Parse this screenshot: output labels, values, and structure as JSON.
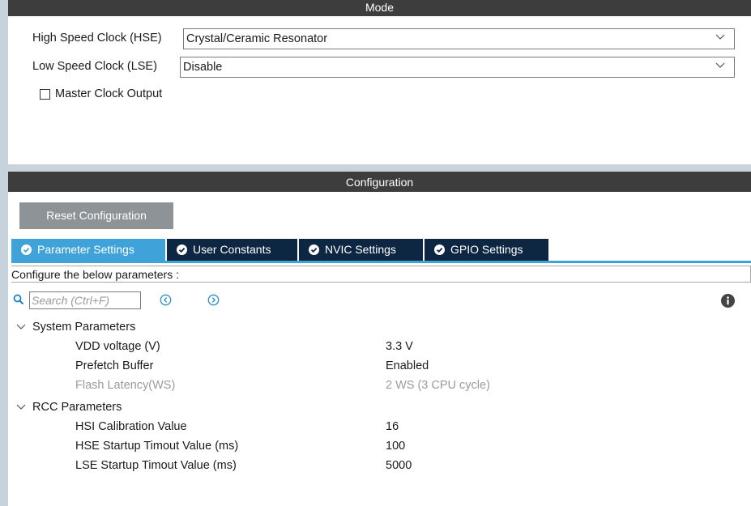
{
  "mode": {
    "title": "Mode",
    "hse": {
      "label": "High Speed Clock (HSE)",
      "value": "Crystal/Ceramic Resonator"
    },
    "lse": {
      "label": "Low Speed Clock (LSE)",
      "value": "Disable"
    },
    "mco": {
      "label": "Master Clock Output",
      "checked": false
    }
  },
  "config": {
    "title": "Configuration",
    "reset_label": "Reset Configuration",
    "tabs": [
      {
        "label": "Parameter Settings",
        "active": true
      },
      {
        "label": "User Constants",
        "active": false
      },
      {
        "label": "NVIC Settings",
        "active": false
      },
      {
        "label": "GPIO Settings",
        "active": false
      }
    ],
    "description": "Configure the below parameters :",
    "search_placeholder": "Search (Ctrl+F)",
    "groups": [
      {
        "label": "System Parameters",
        "params": [
          {
            "name": "VDD voltage (V)",
            "value": "3.3 V",
            "disabled": false
          },
          {
            "name": "Prefetch Buffer",
            "value": "Enabled",
            "disabled": false
          },
          {
            "name": "Flash Latency(WS)",
            "value": "2 WS (3 CPU cycle)",
            "disabled": true
          }
        ]
      },
      {
        "label": "RCC Parameters",
        "params": [
          {
            "name": "HSI Calibration Value",
            "value": "16",
            "disabled": false
          },
          {
            "name": "HSE Startup Timout Value (ms)",
            "value": "100",
            "disabled": false
          },
          {
            "name": "LSE Startup Timout Value (ms)",
            "value": "5000",
            "disabled": false
          }
        ]
      }
    ]
  },
  "colors": {
    "header_bg": "#3d3d3d",
    "tab_active": "#3fa3da",
    "tab_inactive": "#0d2743",
    "reset_button": "#8e9397",
    "disabled_text": "#9b9b9b"
  },
  "icons": [
    "chevron-down-icon",
    "checkbox-icon",
    "check-circle-icon",
    "search-icon",
    "prev-arrow-icon",
    "next-arrow-icon",
    "info-icon"
  ]
}
